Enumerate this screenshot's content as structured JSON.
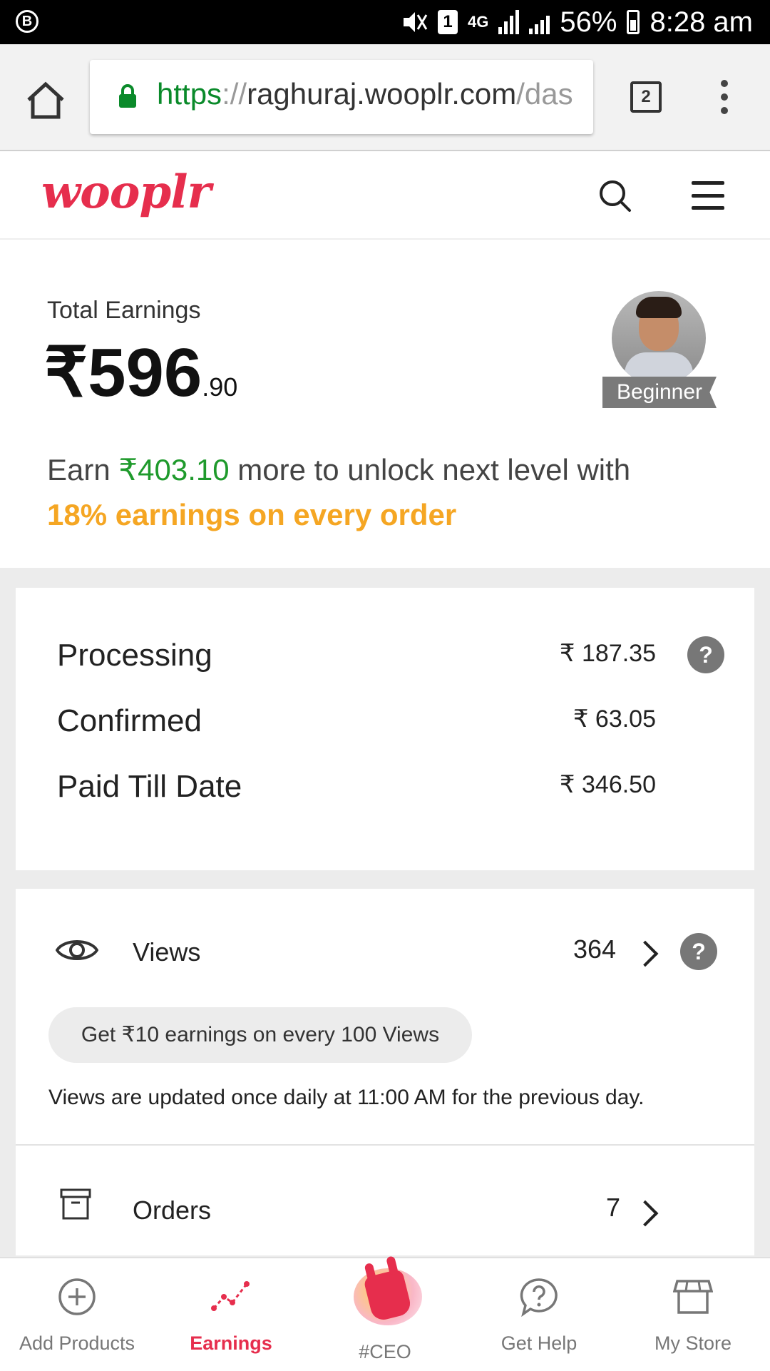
{
  "status_bar": {
    "notification_letter": "B",
    "sim": "1",
    "network": "4G",
    "battery": "56%",
    "time": "8:28 am"
  },
  "browser": {
    "url_scheme": "https",
    "url_sep": "://",
    "url_host": "raghuraj.wooplr.com",
    "url_path": "/das",
    "tab_count": "2"
  },
  "site": {
    "logo": "wooplr"
  },
  "earnings": {
    "total_label": "Total Earnings",
    "currency": "₹",
    "total_whole": "596",
    "total_decimal": ".90",
    "level": "Beginner",
    "unlock_prefix": "Earn ",
    "unlock_amount": "₹403.10",
    "unlock_suffix": " more to unlock next level with",
    "unlock_benefit": "18% earnings on every order"
  },
  "status": {
    "help": "?",
    "rows": [
      {
        "label": "Processing",
        "value": "₹ 187.35"
      },
      {
        "label": "Confirmed",
        "value": "₹ 63.05"
      },
      {
        "label": "Paid Till Date",
        "value": "₹ 346.50"
      }
    ]
  },
  "views": {
    "label": "Views",
    "count": "364",
    "help": "?",
    "promo": "Get ₹10 earnings on every 100 Views",
    "note": "Views are updated once daily at 11:00 AM for the previous day."
  },
  "orders": {
    "label": "Orders",
    "count": "7"
  },
  "bottom_nav": {
    "items": [
      {
        "label": "Add Products",
        "icon": "plus-circle-icon"
      },
      {
        "label": "Earnings",
        "icon": "trend-line-icon"
      },
      {
        "label": "#CEO",
        "icon": "rock-hand-icon"
      },
      {
        "label": "Get Help",
        "icon": "question-bubble-icon"
      },
      {
        "label": "My Store",
        "icon": "store-icon"
      }
    ],
    "active_index": 1
  },
  "colors": {
    "brand": "#e62e4d",
    "positive": "#1f9a2c",
    "highlight": "#f5a623"
  }
}
